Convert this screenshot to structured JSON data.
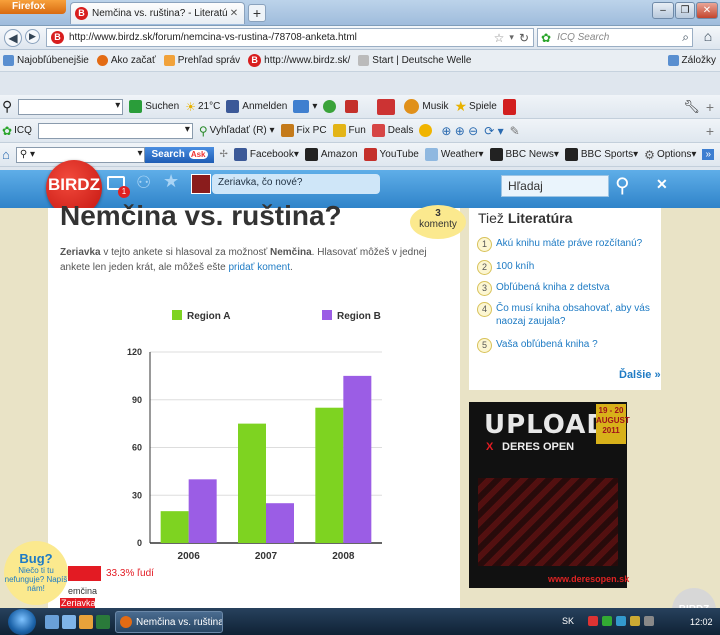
{
  "browser": {
    "app_button": "Firefox",
    "tab_title": "Nemčina vs. ruština? - Literatúra - Fórum...",
    "url": "http://www.birdz.sk/forum/nemcina-vs-rustina-/78708-anketa.html",
    "search_placeholder": "ICQ Search",
    "window_controls": [
      "–",
      "❐",
      "✕"
    ]
  },
  "bookmarks": [
    "Najobľúbenejšie",
    "Ako začať",
    "Prehľad správ",
    "http://www.birdz.sk/",
    "Start | Deutsche Welle"
  ],
  "bookmarks_right": "Záložky",
  "toolbar1": {
    "suchen": "Suchen",
    "temp": "21°C",
    "anmelden": "Anmelden",
    "musik": "Musik",
    "spiele": "Spiele"
  },
  "toolbar2": {
    "icq": "ICQ",
    "vyhladat": "Vyhľadať",
    "fixpc": "Fix PC",
    "fun": "Fun",
    "deals": "Deals"
  },
  "toolbar3": {
    "search_btn": "Search",
    "ask": "Ask",
    "facebook": "Facebook",
    "amazon": "Amazon",
    "youtube": "YouTube",
    "weather": "Weather",
    "bbcnews": "BBC News",
    "bbcsports": "BBC Sports",
    "options": "Options"
  },
  "site": {
    "logo": "BIRDZ",
    "status_placeholder": "Zeriavka, čo nové?",
    "search_placeholder": "Hľadaj",
    "notif_count": "1"
  },
  "post": {
    "title": "Nemčina vs. ruština?",
    "comments_count": "3",
    "comments_label": "komenty",
    "intro_user": "Zeriavka",
    "intro_text1": " v tejto ankete si hlasoval za možnosť ",
    "intro_option": "Nemčina",
    "intro_text2": ". Hlasovať môžeš v jednej ankete len jeden krát, ale môžeš ešte ",
    "intro_link": "pridať koment",
    "intro_end": "."
  },
  "sidebar": {
    "title_prefix": "Tiež ",
    "title_strong": "Literatúra",
    "items": [
      {
        "n": "1",
        "text": "Akú knihu máte práve rozčítanú?"
      },
      {
        "n": "2",
        "text": "100 kníh"
      },
      {
        "n": "3",
        "text": "Obľúbená kniha z detstva"
      },
      {
        "n": "4",
        "text": "Čo musí kniha obsahovať, aby vás naozaj zaujala?"
      },
      {
        "n": "5",
        "text": "Vaša obľúbená kniha ?"
      }
    ],
    "more": "Ďalšie »"
  },
  "ad": {
    "upload": "UPLOAD",
    "deres": "DERES OPEN",
    "x": "X",
    "date": "19 - 20 AUGUST 2011",
    "site": "www.deresopen.sk"
  },
  "bug": {
    "title": "Bug?",
    "text": "Niečo ti tu nefunguje? Napíš nám!"
  },
  "poll": {
    "pct": "33.3% ľudí",
    "opt1": "emčina",
    "opt2": "Zeriavka",
    "fraction": 0.333
  },
  "corner_logo": "BIRDZ",
  "taskbar": {
    "task": "Nemčina vs. ruština...",
    "lang": "SK",
    "clock": "12:02"
  },
  "colors": {
    "regionA": "#7ed321",
    "regionB": "#9b5de5",
    "accent": "#1e7bc4",
    "brand": "#d81e1e"
  },
  "chart_data": {
    "type": "bar",
    "categories": [
      "2006",
      "2007",
      "2008"
    ],
    "series": [
      {
        "name": "Region A",
        "values": [
          20,
          75,
          85
        ]
      },
      {
        "name": "Region B",
        "values": [
          40,
          25,
          105
        ]
      }
    ],
    "yticks": [
      0,
      30,
      60,
      90,
      120
    ],
    "ylim": [
      0,
      120
    ],
    "grid": true,
    "legend": "top"
  }
}
